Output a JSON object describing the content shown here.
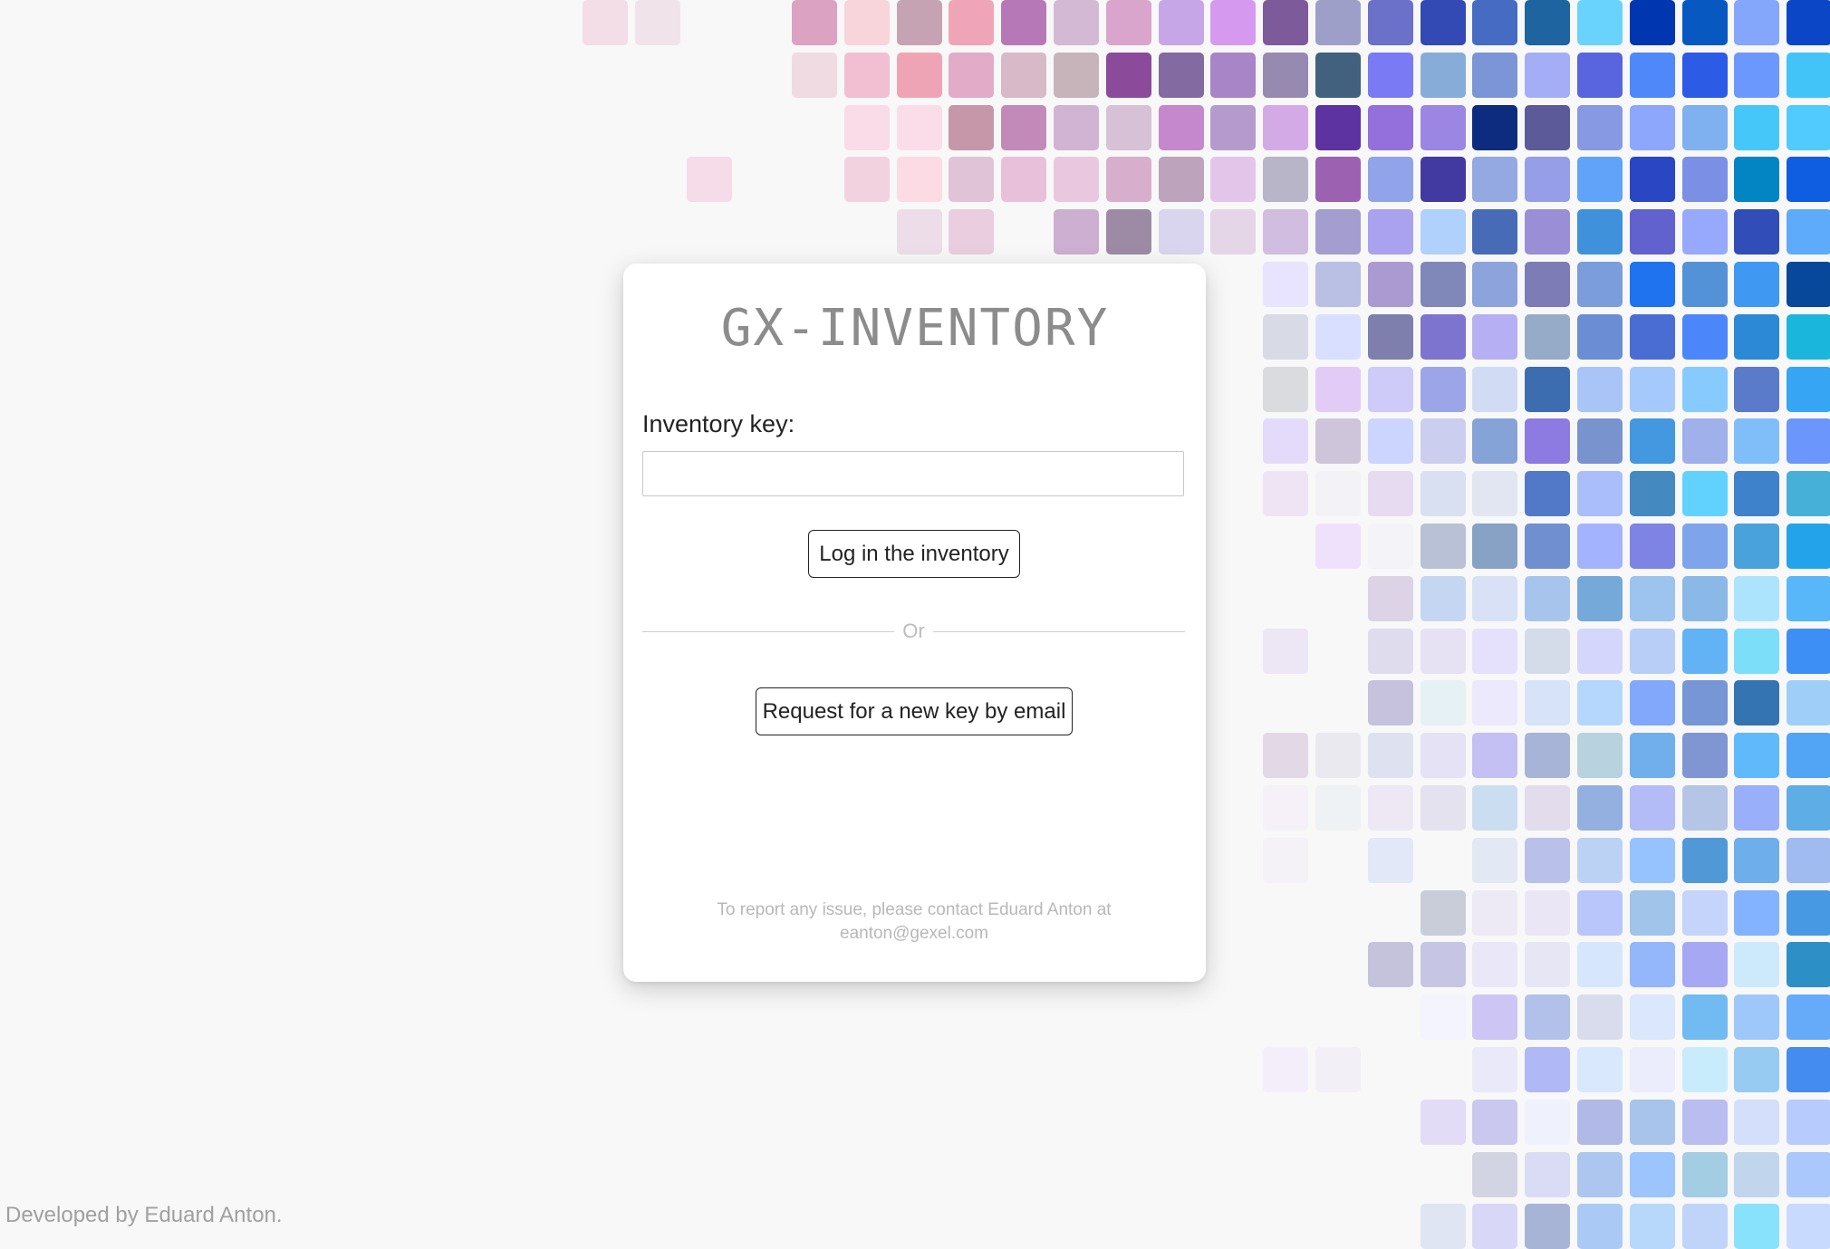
{
  "app": {
    "title": "GX-INVENTORY"
  },
  "login_form": {
    "key_label": "Inventory key:",
    "key_value": "",
    "key_placeholder": "",
    "login_button": "Log in the inventory",
    "divider_text": "Or",
    "request_button": "Request for a new key by email",
    "contact_text": "To report any issue, please contact Eduard Anton at eanton@gexel.com"
  },
  "footer": {
    "credit": "Developed by Eduard Anton."
  },
  "background": {
    "tile_rows": [
      [
        null,
        null,
        null,
        null,
        null,
        null,
        null,
        null,
        null,
        null,
        null,
        "#f3dde7",
        "#f1e3ea",
        null,
        null,
        "#dca2c2",
        "#f8d4db",
        "#c6a3b3",
        "#efa4b7",
        "#b778b7",
        "#d4b9d4",
        "#d9a5cc",
        "#c7a6e8",
        "#d59af0",
        "#7d5b9a",
        "#9e9fc9",
        "#6b70c8",
        "#3349b3",
        "#456bc3",
        "#1e64a0",
        "#69d3fd",
        "#0037b0",
        "#0858c1",
        "#84a7fc",
        "#0b46c7",
        "#67d0fe"
      ],
      [
        null,
        null,
        null,
        null,
        null,
        null,
        null,
        null,
        null,
        null,
        null,
        null,
        null,
        null,
        null,
        "#f1dbe2",
        "#f1bfd1",
        "#efa4b6",
        "#e2abc8",
        "#d8b9c7",
        "#c7b4bb",
        "#8b4b9a",
        "#836aa0",
        "#a785c7",
        "#978ab0",
        "#41617e",
        "#797af4",
        "#88acd8",
        "#7b95d6",
        "#a4aef6",
        "#5865de",
        "#4f88f9",
        "#2c5be6",
        "#6b98fd",
        "#42c4f9",
        "#739ffd"
      ],
      [
        null,
        null,
        null,
        null,
        null,
        null,
        null,
        null,
        null,
        null,
        null,
        null,
        null,
        null,
        null,
        null,
        "#f9dce7",
        "#fadde8",
        "#c597a8",
        "#c28ab8",
        "#d1b4d4",
        "#d6c1d7",
        "#c588cc",
        "#b59ace",
        "#d4aae6",
        "#5d33a1",
        "#9470dc",
        "#9b86e4",
        "#0d2c80",
        "#5c5a99",
        "#8799e3",
        "#8ca7fc",
        "#7fb1f0",
        "#46c7f9",
        "#51cbfe",
        "#6a9dfe"
      ],
      [
        null,
        null,
        null,
        null,
        null,
        null,
        null,
        null,
        null,
        null,
        null,
        null,
        null,
        "#f6dbe9",
        null,
        null,
        "#f3d2e0",
        "#fcdbe4",
        "#e0c3d6",
        "#e8c0da",
        "#e9c8df",
        "#d8aecd",
        "#bea3bd",
        "#e3c5ea",
        "#b9b5c8",
        "#9c61b1",
        "#91a4e9",
        "#423aa0",
        "#94a8e2",
        "#979ee8",
        "#61a3f8",
        "#2947c3",
        "#7b90e5",
        "#0485c3",
        "#0f5de1",
        "#0e71fd"
      ],
      [
        null,
        null,
        null,
        null,
        null,
        null,
        null,
        null,
        null,
        null,
        null,
        null,
        null,
        null,
        null,
        null,
        null,
        "#ecdde9",
        "#eacee0",
        null,
        "#cdafd1",
        "#9d8ba6",
        "#d9d5ee",
        "#e4d5e7",
        "#d1bde0",
        "#a39dd0",
        "#aaa1ef",
        "#afd1fc",
        "#476bb6",
        "#9a8fd6",
        "#3f91dc",
        "#6162ce",
        "#96a9fd",
        "#314db8",
        "#5eaafb",
        "#0191e3"
      ],
      [
        null,
        null,
        null,
        null,
        null,
        null,
        null,
        null,
        null,
        null,
        null,
        null,
        null,
        null,
        null,
        null,
        null,
        null,
        null,
        null,
        null,
        null,
        null,
        null,
        "#e8e3fe",
        "#b9c0e3",
        "#ab99d2",
        "#7f88b9",
        "#8ca3db",
        "#7d7cb7",
        "#7c9ddb",
        "#1f73ee",
        "#5492d8",
        "#3f99f3",
        "#07489b",
        "#39a7f8"
      ],
      [
        null,
        null,
        null,
        null,
        null,
        null,
        null,
        null,
        null,
        null,
        null,
        null,
        null,
        null,
        null,
        null,
        null,
        null,
        null,
        null,
        null,
        null,
        null,
        null,
        "#d8dae6",
        "#d9dffe",
        "#7f7fae",
        "#7c74cf",
        "#b6aff3",
        "#96abc8",
        "#6a8dd3",
        "#4a6dd4",
        "#4b87fb",
        "#2b89d6",
        "#1bb6dc",
        "#0b58d1"
      ],
      [
        null,
        null,
        null,
        null,
        null,
        null,
        null,
        null,
        null,
        null,
        null,
        null,
        null,
        null,
        null,
        null,
        null,
        null,
        null,
        null,
        null,
        null,
        null,
        null,
        "#dadbdf",
        "#e3cbf7",
        "#cecbf8",
        "#9da5e9",
        "#d1dcf4",
        "#3d6db1",
        "#a9c5f8",
        "#a5c9fb",
        "#87cafe",
        "#5a7bc9",
        "#35a5f4",
        "#0a90e5"
      ],
      [
        null,
        null,
        null,
        null,
        null,
        null,
        null,
        null,
        null,
        null,
        null,
        null,
        null,
        null,
        null,
        null,
        null,
        null,
        null,
        null,
        null,
        null,
        null,
        null,
        "#e3dbf9",
        "#cec5db",
        "#ccd5fe",
        "#ccceef",
        "#86a3d8",
        "#8e7be1",
        "#7993ce",
        "#4398df",
        "#9fb0eb",
        "#80bef9",
        "#6b96fb",
        "#39cafb"
      ],
      [
        null,
        null,
        null,
        null,
        null,
        null,
        null,
        null,
        null,
        null,
        null,
        null,
        null,
        null,
        null,
        null,
        null,
        null,
        null,
        null,
        null,
        null,
        null,
        null,
        "#efe4f4",
        "#f3f3f7",
        "#e6dbf1",
        "#d8e0f2",
        "#e2e6f2",
        "#5279c7",
        "#aabefb",
        "#448ac1",
        "#61d2fd",
        "#3e82cb",
        "#46b0d8",
        "#3d83fd"
      ],
      [
        null,
        null,
        null,
        null,
        null,
        null,
        null,
        null,
        null,
        null,
        null,
        null,
        null,
        null,
        null,
        null,
        null,
        null,
        null,
        null,
        null,
        null,
        null,
        null,
        null,
        "#efe1fb",
        "#f4f4f8",
        "#b8c1d5",
        "#87a2c5",
        "#6f8fd0",
        "#a4b3fe",
        "#7d84e3",
        "#7ea4ec",
        "#49a2db",
        "#23a3ea",
        "#3b8efd"
      ],
      [
        null,
        null,
        null,
        null,
        null,
        null,
        null,
        null,
        null,
        null,
        null,
        null,
        null,
        null,
        null,
        null,
        null,
        null,
        null,
        null,
        null,
        null,
        null,
        null,
        null,
        null,
        "#dcd3e7",
        "#c4d6f2",
        "#d8e1f6",
        "#a7c5ec",
        "#74a9da",
        "#9cc4ef",
        "#8bb9e7",
        "#ace4fd",
        "#57b7f8",
        "#6fa8e0"
      ],
      [
        null,
        null,
        null,
        null,
        null,
        null,
        null,
        null,
        null,
        null,
        null,
        null,
        null,
        null,
        null,
        null,
        null,
        null,
        null,
        null,
        null,
        null,
        null,
        null,
        "#ede6f4",
        null,
        "#dfdcee",
        "#e7e1f4",
        "#e5e1fc",
        "#d4dcea",
        "#d5d6fc",
        "#b9cef7",
        "#61b3f6",
        "#7ddefa",
        "#3e8ff5",
        "#3e62e8"
      ],
      [
        null,
        null,
        null,
        null,
        null,
        null,
        null,
        null,
        null,
        null,
        null,
        null,
        null,
        null,
        null,
        null,
        null,
        null,
        null,
        null,
        null,
        null,
        null,
        null,
        null,
        null,
        "#c6c1dc",
        "#e6f1f5",
        "#ebe9fb",
        "#d6e3f9",
        "#b5d6fd",
        "#82a8fc",
        "#7696d5",
        "#3474b2",
        "#9fcff9",
        "#62c5f3"
      ],
      [
        null,
        null,
        null,
        null,
        null,
        null,
        null,
        null,
        null,
        null,
        null,
        null,
        null,
        null,
        null,
        null,
        null,
        null,
        null,
        null,
        null,
        null,
        null,
        null,
        "#e3d9e6",
        "#ebe9f0",
        "#dee2f0",
        "#e6e2f5",
        "#c4c0f3",
        "#a7b4d7",
        "#b8d2df",
        "#70afec",
        "#7f96d2",
        "#60b9fb",
        "#52a4f4",
        "#3879de"
      ],
      [
        null,
        null,
        null,
        null,
        null,
        null,
        null,
        null,
        null,
        null,
        null,
        null,
        null,
        null,
        null,
        null,
        null,
        null,
        null,
        null,
        null,
        null,
        null,
        null,
        "#f6f1f8",
        "#eef2f4",
        "#ede8f4",
        "#e4e2ef",
        "#cbddf1",
        "#e3dcec",
        "#93b0e0",
        "#b3bcf6",
        "#b5c5e6",
        "#99aff9",
        "#5fade6",
        "#2289b2"
      ],
      [
        null,
        null,
        null,
        null,
        null,
        null,
        null,
        null,
        null,
        null,
        null,
        null,
        null,
        null,
        null,
        null,
        null,
        null,
        null,
        null,
        null,
        null,
        null,
        null,
        "#f4f1f7",
        null,
        "#e2e8f7",
        null,
        "#e2e8f4",
        "#b9c1ea",
        "#bcd2f5",
        "#96c3fe",
        "#5099d6",
        "#6eaeeb",
        "#9fbbf0",
        "#6394e6"
      ],
      [
        null,
        null,
        null,
        null,
        null,
        null,
        null,
        null,
        null,
        null,
        null,
        null,
        null,
        null,
        null,
        null,
        null,
        null,
        null,
        null,
        null,
        null,
        null,
        null,
        null,
        null,
        null,
        "#c8cdd9",
        "#ede9f5",
        "#eae6f6",
        "#b8c6fb",
        "#a0c4ea",
        "#c5d4fb",
        "#83b2fe",
        "#4899e3",
        "#1f89d9"
      ],
      [
        null,
        null,
        null,
        null,
        null,
        null,
        null,
        null,
        null,
        null,
        null,
        null,
        null,
        null,
        null,
        null,
        null,
        null,
        null,
        null,
        null,
        null,
        null,
        null,
        null,
        null,
        "#c5c3dc",
        "#c6c6e4",
        "#eae7f8",
        "#e6e6f5",
        "#d6e6fc",
        "#94b6fb",
        "#a6a8f4",
        "#cde9fc",
        "#2c90c6",
        "#8bb7e9"
      ],
      [
        null,
        null,
        null,
        null,
        null,
        null,
        null,
        null,
        null,
        null,
        null,
        null,
        null,
        null,
        null,
        null,
        null,
        null,
        null,
        null,
        null,
        null,
        null,
        null,
        null,
        null,
        null,
        "#f3f4fd",
        "#cdc5f3",
        "#b1c1ea",
        "#d8dcec",
        "#dae7fc",
        "#72baf2",
        "#9ec8fa",
        "#66aafa",
        "#98b3ec"
      ],
      [
        null,
        null,
        null,
        null,
        null,
        null,
        null,
        null,
        null,
        null,
        null,
        null,
        null,
        null,
        null,
        null,
        null,
        null,
        null,
        null,
        null,
        null,
        null,
        null,
        "#f4eefa",
        "#f2eff6",
        null,
        null,
        "#e9e9f9",
        "#b0b8f6",
        "#d9e8fd",
        "#ebedfd",
        "#c9ecfc",
        "#98cbf2",
        "#458cf1",
        "#7ac8fc"
      ],
      [
        null,
        null,
        null,
        null,
        null,
        null,
        null,
        null,
        null,
        null,
        null,
        null,
        null,
        null,
        null,
        null,
        null,
        null,
        null,
        null,
        null,
        null,
        null,
        null,
        null,
        null,
        null,
        "#e2dcf7",
        "#cac8ef",
        "#eff2fd",
        "#b1b9e7",
        "#a9c4eb",
        "#b9bdef",
        "#d4e0fb",
        "#b7ccfd",
        "#2f75f5"
      ],
      [
        null,
        null,
        null,
        null,
        null,
        null,
        null,
        null,
        null,
        null,
        null,
        null,
        null,
        null,
        null,
        null,
        null,
        null,
        null,
        null,
        null,
        null,
        null,
        null,
        null,
        null,
        null,
        null,
        "#d2d4e4",
        "#dadcf6",
        "#acc6ef",
        "#9bc5fc",
        "#a2cde3",
        "#c1d5ec",
        "#abc8fc",
        "#7dc5fe"
      ],
      [
        null,
        null,
        null,
        null,
        null,
        null,
        null,
        null,
        null,
        null,
        null,
        null,
        null,
        null,
        null,
        null,
        null,
        null,
        null,
        null,
        null,
        null,
        null,
        null,
        null,
        null,
        null,
        "#dfe5f3",
        "#d9d7f8",
        "#a7b4d5",
        "#aacaf5",
        "#b7d7fb",
        "#bfd4f8",
        "#89e2fc",
        "#c8dafe",
        "#57b0fd"
      ]
    ]
  }
}
